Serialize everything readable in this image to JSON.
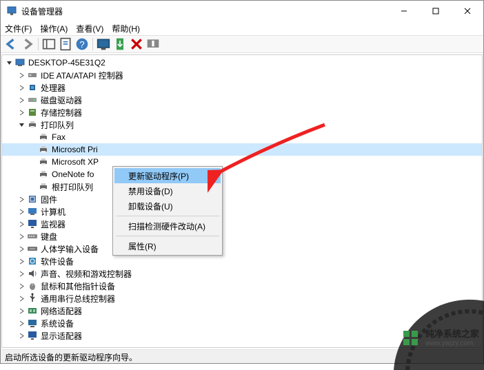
{
  "window": {
    "title": "设备管理器",
    "min": "–",
    "max": "▢",
    "close": "✕"
  },
  "menu": {
    "file": "文件(F)",
    "action": "操作(A)",
    "view": "查看(V)",
    "help": "帮助(H)"
  },
  "tree": {
    "root": "DESKTOP-45E31Q2",
    "categories": {
      "ide": "IDE ATA/ATAPI 控制器",
      "cpu": "处理器",
      "diskdrive": "磁盘驱动器",
      "storage": "存储控制器",
      "printers": "打印队列",
      "firmware": "固件",
      "computer": "计算机",
      "monitor": "监视器",
      "keyboard": "键盘",
      "hid": "人体学输入设备",
      "software": "软件设备",
      "sound": "声音、视频和游戏控制器",
      "mouse": "鼠标和其他指针设备",
      "usb": "通用串行总线控制器",
      "network": "网络适配器",
      "system": "系统设备",
      "display": "显示适配器"
    },
    "printers": {
      "fax": "Fax",
      "mspri": "Microsoft Pri",
      "msxp": "Microsoft XP",
      "onenote": "OneNote fo",
      "root": "根打印队列"
    }
  },
  "context_menu": {
    "update": "更新驱动程序(P)",
    "disable": "禁用设备(D)",
    "uninstall": "卸载设备(U)",
    "scan": "扫描检测硬件改动(A)",
    "properties": "属性(R)"
  },
  "statusbar": "启动所选设备的更新驱动程序向导。",
  "watermark": {
    "brand": "纯净系统之家",
    "url": "www.ywjzy.com"
  }
}
